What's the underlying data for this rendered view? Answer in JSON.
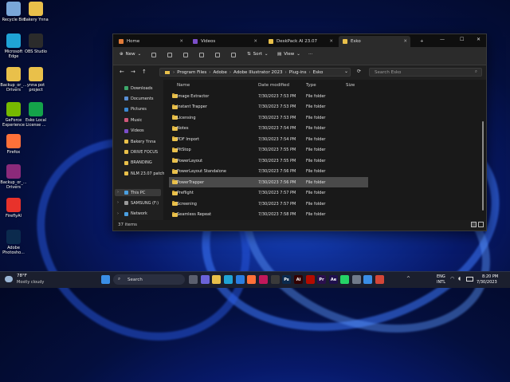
{
  "desktop": {
    "icons": [
      {
        "label": "Recycle Bin",
        "icon": "recycle-bin-icon",
        "color": "#7aa7d8"
      },
      {
        "label": "Bakery Ynna",
        "icon": "folder-icon",
        "color": "#e9c04a"
      },
      {
        "label": "Microsoft Edge",
        "icon": "edge-icon",
        "color": "#1fa3d6"
      },
      {
        "label": "OBS Studio",
        "icon": "obs-icon",
        "color": "#2b2b2b"
      },
      {
        "label": "Backup_or_... Drivers",
        "icon": "folder-icon",
        "color": "#e9c04a"
      },
      {
        "label": "ynna pot project",
        "icon": "folder-icon",
        "color": "#e9c04a"
      },
      {
        "label": "GeForce Experience",
        "icon": "geforce-icon",
        "color": "#76b900"
      },
      {
        "label": "Esko Local License ...",
        "icon": "esko-icon",
        "color": "#14a34a"
      },
      {
        "label": "Firefox",
        "icon": "firefox-icon",
        "color": "#ff7139"
      },
      {
        "label": "Backup_or_... Drivers",
        "icon": "winrar-icon",
        "color": "#8b2a7a"
      },
      {
        "label": "FireflyAI",
        "icon": "firefly-icon",
        "color": "#e8322b"
      },
      {
        "label": "Adobe Photosho...",
        "icon": "photoshop-icon",
        "color": "#0b2a4d"
      }
    ]
  },
  "explorer": {
    "tabs": [
      {
        "label": "Home",
        "icon": "home-icon",
        "color": "#e07b39"
      },
      {
        "label": "Videos",
        "icon": "videos-icon",
        "color": "#7b4ec9"
      },
      {
        "label": "DeskPack AI 23.07",
        "icon": "folder-icon",
        "color": "#e9c04a"
      },
      {
        "label": "Esko",
        "icon": "folder-icon",
        "color": "#e9c04a"
      }
    ],
    "toolbar": {
      "new": "New",
      "sort": "Sort",
      "view": "View",
      "more": "···"
    },
    "address": [
      "Program Files",
      "Adobe",
      "Adobe Illustrator 2023",
      "Plug-ins",
      "Esko"
    ],
    "search_placeholder": "Search Esko",
    "nav": [
      {
        "label": "Downloads",
        "icon": "downloads-icon",
        "color": "#3ea86b"
      },
      {
        "label": "Documents",
        "icon": "documents-icon",
        "color": "#5a8fd6"
      },
      {
        "label": "Pictures",
        "icon": "pictures-icon",
        "color": "#3a86d0"
      },
      {
        "label": "Music",
        "icon": "music-icon",
        "color": "#d0577a"
      },
      {
        "label": "Videos",
        "icon": "videos-icon",
        "color": "#7b4ec9"
      },
      {
        "label": "Bakery Ynna",
        "icon": "folder-icon",
        "color": "#e9c04a"
      },
      {
        "label": "DRIVE FOCUS",
        "icon": "folder-icon",
        "color": "#e9c04a"
      },
      {
        "label": "BRANDING",
        "icon": "folder-icon",
        "color": "#e9c04a"
      },
      {
        "label": "NLM 23.07 patch",
        "icon": "folder-icon",
        "color": "#e9c04a"
      }
    ],
    "nav2": [
      {
        "label": "This PC",
        "icon": "pc-icon",
        "color": "#4a9fe0"
      },
      {
        "label": "SAMSUNG (F:)",
        "icon": "drive-icon",
        "color": "#9a9a9a"
      },
      {
        "label": "Network",
        "icon": "network-icon",
        "color": "#4a9fe0"
      }
    ],
    "columns": [
      "Name",
      "Date modified",
      "Type",
      "Size"
    ],
    "rows": [
      {
        "name": "Image Extractor",
        "date": "7/30/2023 7:53 PM",
        "type": "File folder"
      },
      {
        "name": "Instant Trapper",
        "date": "7/30/2023 7:53 PM",
        "type": "File folder"
      },
      {
        "name": "Licensing",
        "date": "7/30/2023 7:53 PM",
        "type": "File folder"
      },
      {
        "name": "Notes",
        "date": "7/30/2023 7:54 PM",
        "type": "File folder"
      },
      {
        "name": "PDF Import",
        "date": "7/30/2023 7:54 PM",
        "type": "File folder"
      },
      {
        "name": "PitStop",
        "date": "7/30/2023 7:55 PM",
        "type": "File folder"
      },
      {
        "name": "PowerLayout",
        "date": "7/30/2023 7:55 PM",
        "type": "File folder"
      },
      {
        "name": "PowerLayout Standalone",
        "date": "7/30/2023 7:56 PM",
        "type": "File folder"
      },
      {
        "name": "PowerTrapper",
        "date": "7/30/2023 7:56 PM",
        "type": "File folder"
      },
      {
        "name": "Preflight",
        "date": "7/30/2023 7:57 PM",
        "type": "File folder"
      },
      {
        "name": "Screening",
        "date": "7/30/2023 7:57 PM",
        "type": "File folder"
      },
      {
        "name": "Seamless Repeat",
        "date": "7/30/2023 7:58 PM",
        "type": "File folder"
      }
    ],
    "status": "37 items"
  },
  "taskbar": {
    "weather_temp": "78°F",
    "weather_desc": "Mostly cloudy",
    "search": "Search",
    "apps": [
      {
        "icon": "windows-icon",
        "label": "",
        "color": "#3a8ee6"
      },
      {
        "icon": "task-view-icon",
        "label": "",
        "color": "#5b5f6e"
      },
      {
        "icon": "chat-icon",
        "label": "",
        "color": "#6b63d8"
      },
      {
        "icon": "file-explorer-icon",
        "label": "",
        "color": "#e9c04a"
      },
      {
        "icon": "edge-icon",
        "label": "",
        "color": "#1fa3d6"
      },
      {
        "icon": "store-icon",
        "label": "",
        "color": "#2a7de1"
      },
      {
        "icon": "firefox-icon",
        "label": "",
        "color": "#ff7139"
      },
      {
        "icon": "app-icon",
        "label": "",
        "color": "#c2185b"
      },
      {
        "icon": "obs-icon",
        "label": "",
        "color": "#3a3a3a"
      },
      {
        "icon": "photoshop-icon",
        "label": "Ps",
        "color": "#0b2a4d"
      },
      {
        "icon": "illustrator-icon",
        "label": "Ai",
        "color": "#330000"
      },
      {
        "icon": "acrobat-icon",
        "label": "",
        "color": "#b30b00"
      },
      {
        "icon": "premiere-icon",
        "label": "Pr",
        "color": "#2a0f4d"
      },
      {
        "icon": "after-effects-icon",
        "label": "Ae",
        "color": "#1f0f4d"
      },
      {
        "icon": "whatsapp-icon",
        "label": "",
        "color": "#25d366"
      },
      {
        "icon": "settings-icon",
        "label": "",
        "color": "#707a8a"
      },
      {
        "icon": "app2-icon",
        "label": "",
        "color": "#3a8ee6"
      },
      {
        "icon": "gmail-icon",
        "label": "",
        "color": "#d44638"
      }
    ],
    "lang1": "ENG",
    "lang2": "INTL",
    "time": "8:20 PM",
    "date": "7/30/2023"
  }
}
